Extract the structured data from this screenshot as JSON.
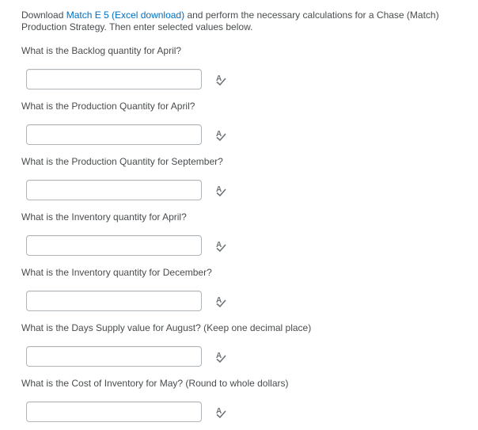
{
  "intro": {
    "prefix": "Download ",
    "link_text": "Match E 5 (Excel download)",
    "suffix": " and perform the necessary calculations for a Chase (Match) Production Strategy.  Then enter selected values below."
  },
  "questions": [
    {
      "label": "What is the Backlog quantity for April?",
      "value": ""
    },
    {
      "label": "What is the Production Quantity for April?",
      "value": ""
    },
    {
      "label": "What is the Production Quantity for September?",
      "value": ""
    },
    {
      "label": "What is the Inventory quantity for April?",
      "value": ""
    },
    {
      "label": "What is the Inventory quantity for December?",
      "value": ""
    },
    {
      "label": "What is the Days Supply value for August?  (Keep one decimal place)",
      "value": ""
    },
    {
      "label": "What is the Cost of Inventory for May?  (Round to whole dollars)",
      "value": ""
    }
  ],
  "icons": {
    "spell_check": "spell-check-icon"
  },
  "colors": {
    "text": "#494c4e",
    "link": "#006fbf",
    "input_border": "#b0b5b9"
  }
}
